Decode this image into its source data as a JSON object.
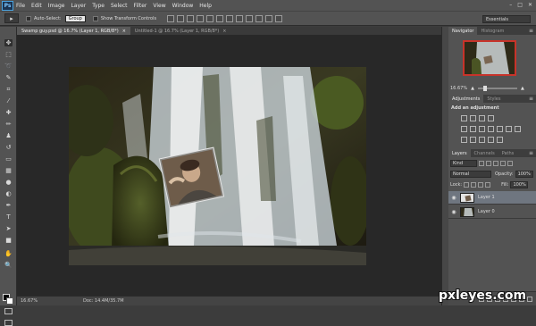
{
  "app": {
    "logo": "Ps",
    "menu": [
      "File",
      "Edit",
      "Image",
      "Layer",
      "Type",
      "Select",
      "Filter",
      "View",
      "Window",
      "Help"
    ],
    "window_controls": [
      "–",
      "□",
      "✕"
    ]
  },
  "options": {
    "tool_preset": "▸",
    "auto_select_label": "Auto-Select:",
    "auto_select_value": "Group",
    "show_transform_label": "Show Transform Controls",
    "workspace": "Essentials"
  },
  "tabs": [
    {
      "label": "Swamp guy.psd @ 16.7% (Layer 1, RGB/8*)",
      "close": "×"
    },
    {
      "label": "Untitled-1 @ 16.7% (Layer 1, RGB/8*)",
      "close": "×"
    }
  ],
  "status": {
    "zoom": "16.67%",
    "doc_size": "Doc: 14.4M/35.7M"
  },
  "panels": {
    "navigator": {
      "tabs": [
        "Navigator",
        "Histogram"
      ],
      "zoom": "16.67%"
    },
    "adjustments": {
      "tabs": [
        "Adjustments",
        "Styles"
      ],
      "title": "Add an adjustment"
    },
    "layers": {
      "tabs": [
        "Layers",
        "Channels",
        "Paths"
      ],
      "kind": "Kind",
      "blend_mode": "Normal",
      "opacity_label": "Opacity:",
      "opacity_value": "100%",
      "lock_label": "Lock:",
      "fill_label": "Fill:",
      "fill_value": "100%",
      "items": [
        {
          "name": "Layer 1",
          "selected": true
        },
        {
          "name": "Layer 0",
          "selected": false
        }
      ]
    }
  },
  "watermark": "pxleyes.com"
}
